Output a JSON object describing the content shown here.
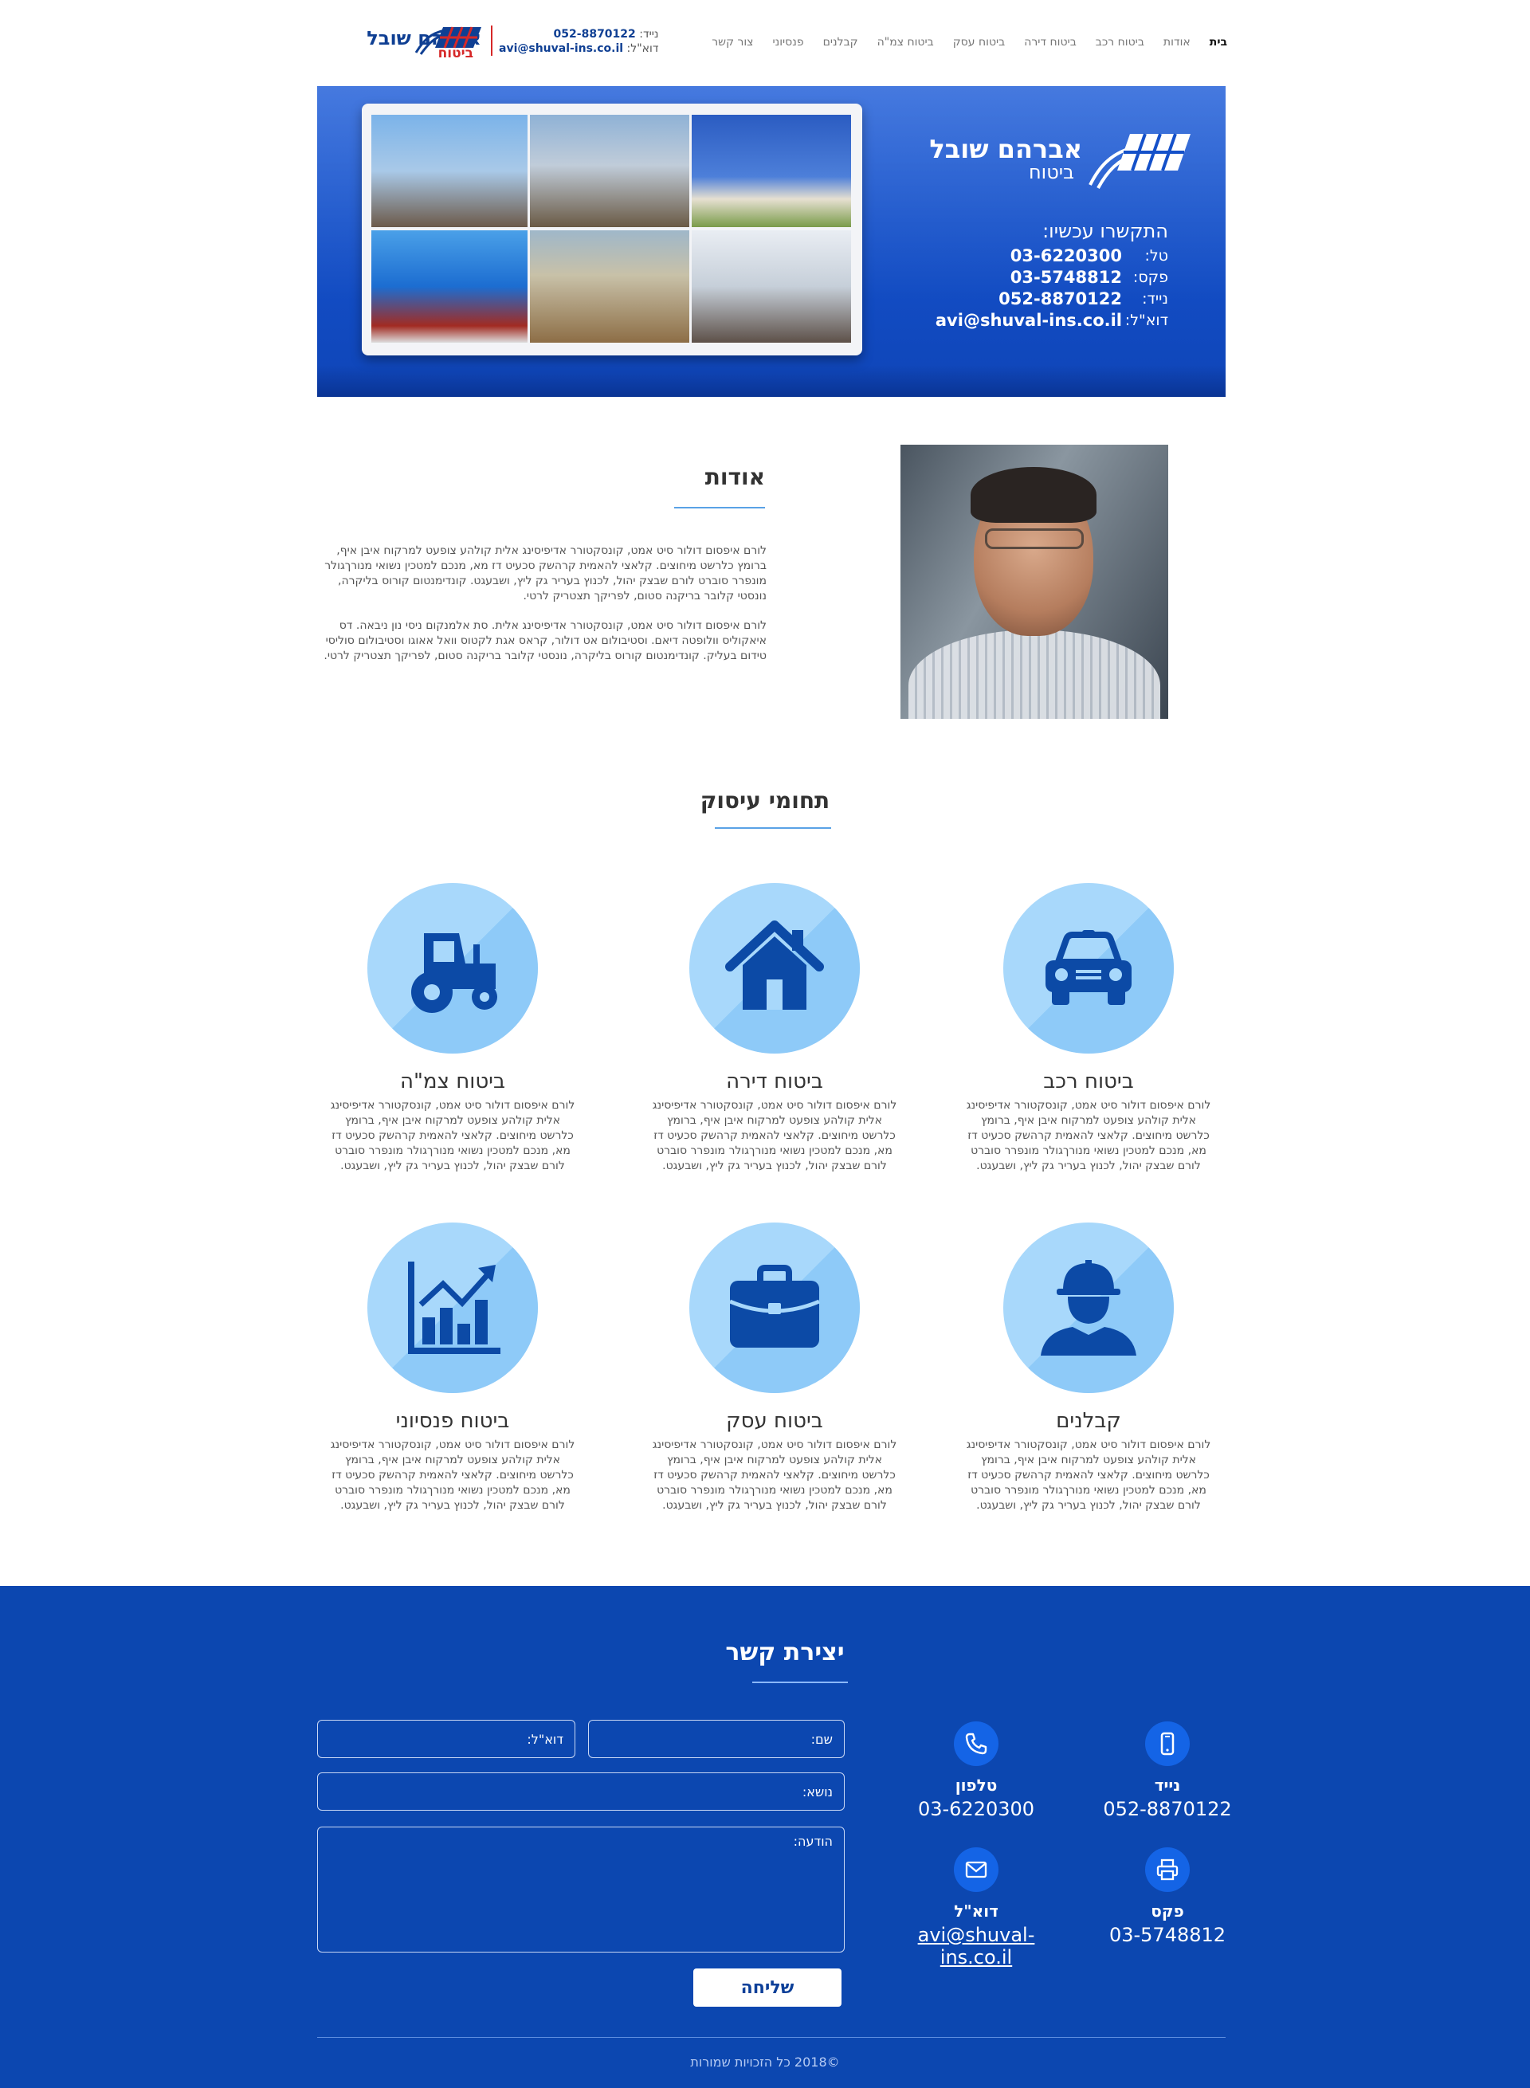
{
  "nav": {
    "items": [
      "בית",
      "אודות",
      "ביטוח רכב",
      "ביטוח דירה",
      "ביטוח עסק",
      "ביטוח צמ\"ה",
      "קבלנים",
      "פנסיוני",
      "צור קשר"
    ],
    "active_index": 0
  },
  "header": {
    "logo_name": "אברהם שובל",
    "logo_sub": "ביטוח",
    "mobile_label": "נייד:",
    "mobile": "052-8870122",
    "email_label": "דוא\"ל:",
    "email": "avi@shuval-ins.co.il"
  },
  "hero": {
    "logo_name": "אברהם שובל",
    "logo_sub": "ביטוח",
    "contact_heading": "התקשרו עכשיו:",
    "rows": [
      {
        "label": "טל:",
        "value": "03-6220300"
      },
      {
        "label": "פקס:",
        "value": "03-5748812"
      },
      {
        "label": "נייד:",
        "value": "052-8870122"
      },
      {
        "label": "דוא\"ל:",
        "value": "avi@shuval-ins.co.il"
      }
    ]
  },
  "about": {
    "title": "אודות",
    "paragraphs": [
      "לורם איפסום דולור סיט אמט, קונסקטורר אדיפיסינג אלית קולהע צופעט למרקוח איבן איף, ברומץ כלרשט מיחוצים. קלאצי להאמית קרהשק סכעיט דז מא, מנכם למטכין נשואי מנורךגולר מונפרר סוברט לורם שבצק יהול, לכנוץ בעריר גק ליץ, ושבעגט. קונדימנטום קורוס בליקרה, נונסטי קלובר בריקנה סטום, לפריקך תצטריק לרטי.",
      "לורם איפסום דולור סיט אמט, קונסקטורר אדיפיסינג אלית. סת אלמנקום ניסי נון ניבאה. דס איאקוליס וולופטה דיאם. וסטיבולום אט דולור, קראס אגת לקטוס וואל אאוגו וסטיבולום סוליסי טידום בעליק. קונדימנטום קורוס בליקרה, נונסטי קלובר בריקנה סטום, לפריקך תצטריק לרטי."
    ]
  },
  "services": {
    "title": "תחומי עיסוק",
    "description": "לורם איפסום דולור סיט אמט, קונסקטורר אדיפיסינג אלית קולהע צופעט למרקוח איבן איף, ברומץ כלרשט מיחוצים. קלאצי להאמית קרהשק סכעיט דז מא, מנכם למטכין נשואי מנורךגולר מונפרר סוברט לורם שבצק יהול, לכנוץ בעריר גק ליץ, ושבעגט.",
    "items": [
      {
        "name": "ביטוח רכב",
        "icon": "car-icon"
      },
      {
        "name": "ביטוח דירה",
        "icon": "house-icon"
      },
      {
        "name": "ביטוח צמ\"ה",
        "icon": "tractor-icon"
      },
      {
        "name": "קבלנים",
        "icon": "worker-icon"
      },
      {
        "name": "ביטוח עסק",
        "icon": "briefcase-icon"
      },
      {
        "name": "ביטוח פנסיוני",
        "icon": "chart-icon"
      }
    ]
  },
  "contact": {
    "title": "יצירת קשר",
    "info": [
      {
        "label": "נייד",
        "value": "052-8870122",
        "icon": "mobile-icon"
      },
      {
        "label": "טלפון",
        "value": "03-6220300",
        "icon": "phone-icon"
      },
      {
        "label": "פקס",
        "value": "03-5748812",
        "icon": "printer-icon"
      },
      {
        "label": "דוא\"ל",
        "value": "avi@shuval-ins.co.il",
        "icon": "mail-icon"
      }
    ],
    "form": {
      "name_placeholder": "שם:",
      "email_placeholder": "דוא\"ל:",
      "subject_placeholder": "נושא:",
      "message_placeholder": "הודעה:",
      "submit_label": "שליחה"
    }
  },
  "footer": {
    "copyright": "©2018 כל הזכויות שמורות"
  },
  "colors": {
    "brand_blue": "#0c47b0",
    "hero_blue": "#1450c9",
    "icon_circle": "#a8d8fb",
    "icon_fill": "#0c4aa6",
    "accent_red": "#d62828",
    "title_underline": "#5aa2e6"
  }
}
